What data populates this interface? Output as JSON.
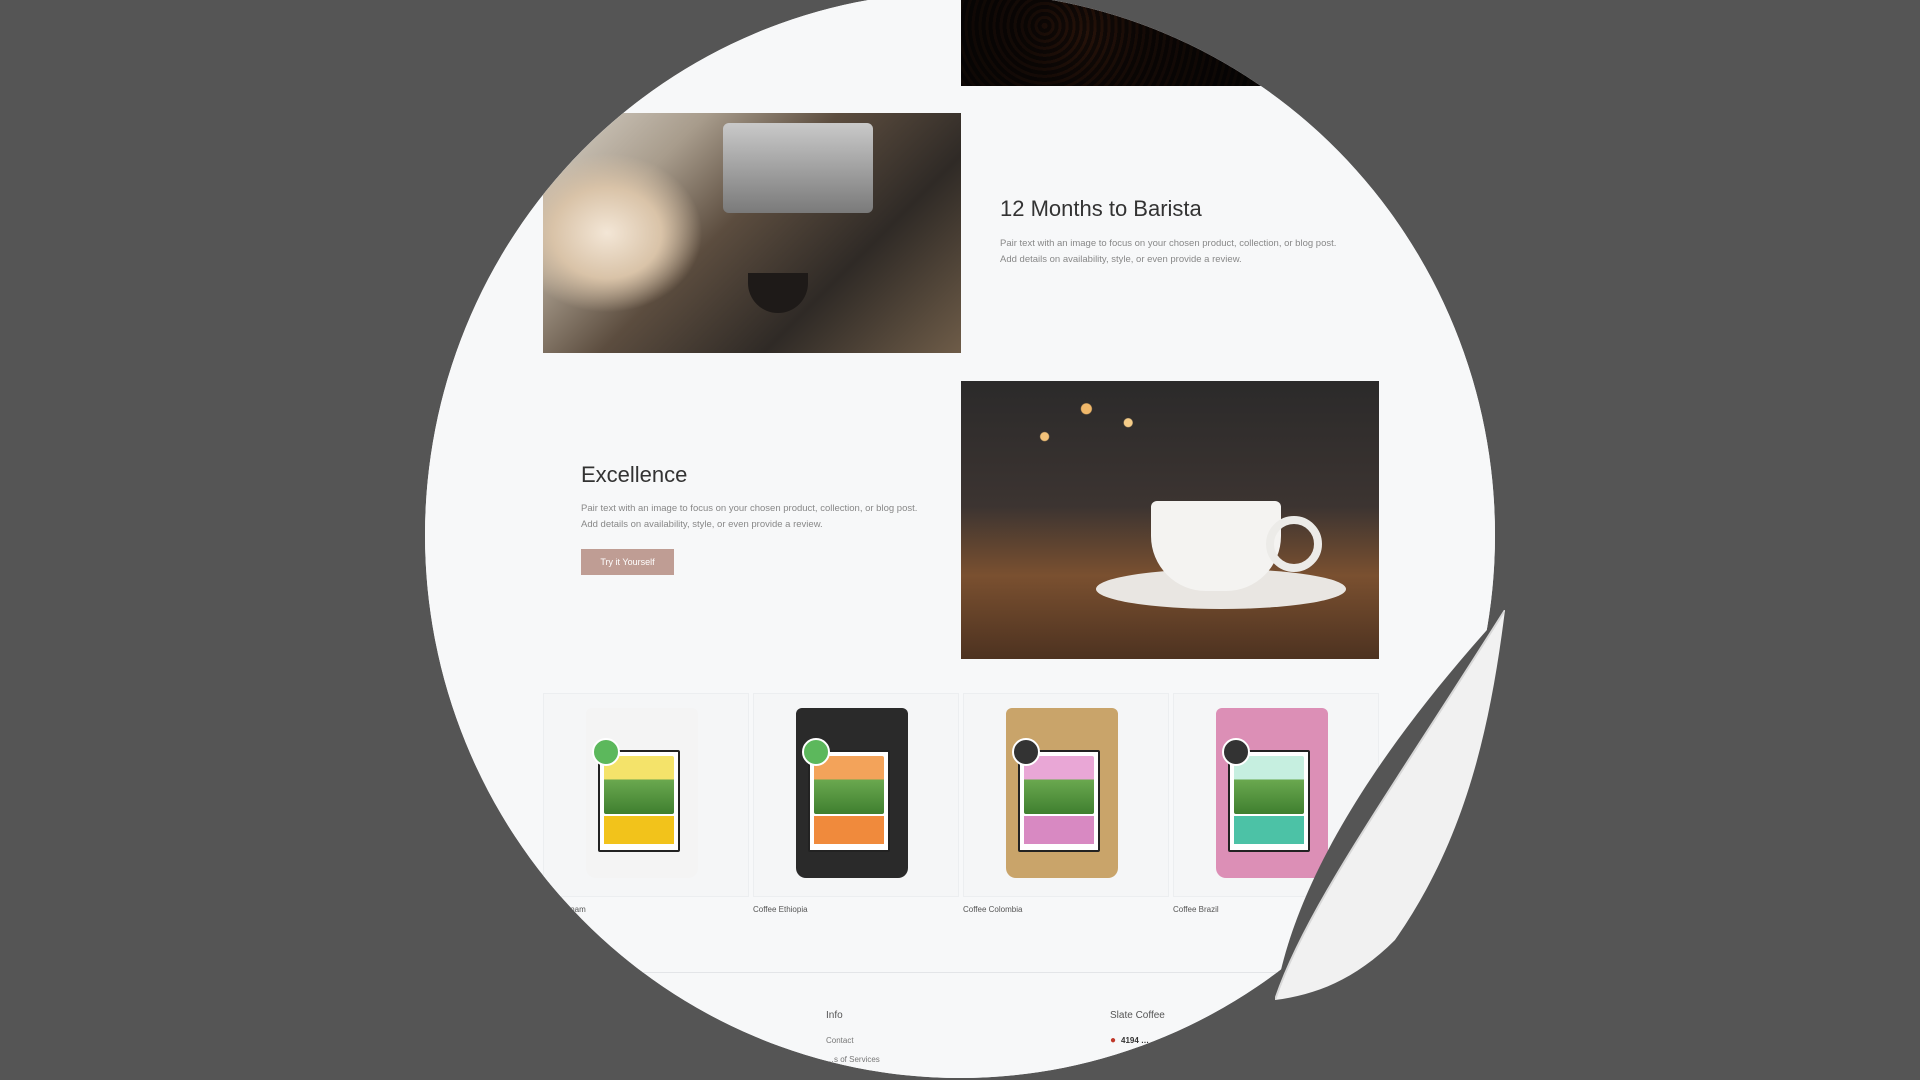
{
  "sections": {
    "barista": {
      "title": "12 Months to Barista",
      "body": "Pair text with an image to focus on your chosen product, collection, or blog post. Add details on availability, style, or even provide a review."
    },
    "excellence": {
      "title": "Excellence",
      "body": "Pair text with an image to focus on your chosen product, collection, or blog post. Add details on availability, style, or even provide a review.",
      "button": "Try it Yourself"
    }
  },
  "products": [
    {
      "name": "…tnam",
      "bag_color": "#f4f4f4",
      "band_color": "#f2c31b",
      "scene_top": "#f4e36a",
      "logo_color": "#5cb85c"
    },
    {
      "name": "Coffee Ethiopia",
      "bag_color": "#2a2a2a",
      "band_color": "#f08a3c",
      "scene_top": "#f3a35a",
      "logo_color": "#5cb85c"
    },
    {
      "name": "Coffee Colombia",
      "bag_color": "#c9a46a",
      "band_color": "#d889c2",
      "scene_top": "#e9a7d6",
      "logo_color": "#333333"
    },
    {
      "name": "Coffee Brazil",
      "bag_color": "#dc8fb6",
      "band_color": "#4cc2a6",
      "scene_top": "#c6efe0",
      "logo_color": "#333333"
    }
  ],
  "footer": {
    "info_heading": "Info",
    "info_links": [
      "Contact",
      "…s of Services"
    ],
    "brand_heading": "Slate Coffee",
    "address": "4194 …"
  },
  "colors": {
    "background": "#555555",
    "page": "#f7f8f9",
    "accent": "#bf9d94"
  },
  "icons": {
    "pin": "location-pin-icon"
  }
}
